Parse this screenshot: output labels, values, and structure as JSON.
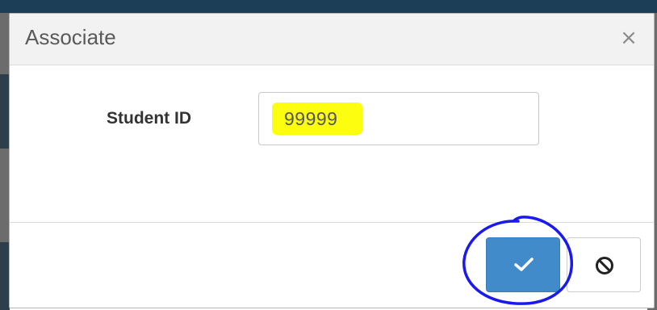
{
  "dialog": {
    "title": "Associate",
    "close_label": "×"
  },
  "form": {
    "student_id_label": "Student ID",
    "student_id_value": "99999"
  },
  "footer": {
    "confirm_icon": "check-icon",
    "cancel_icon": "ban-icon"
  },
  "colors": {
    "primary": "#428bca",
    "highlight": "#fdfd10",
    "annotation": "#1a1af0"
  }
}
